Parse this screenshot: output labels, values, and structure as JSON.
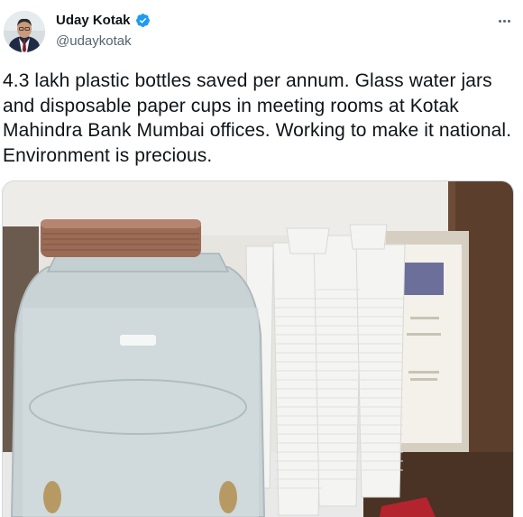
{
  "author": {
    "name": "Uday Kotak",
    "handle": "@udaykotak",
    "verified": true,
    "avatar_icon": "profile-photo"
  },
  "menu": {
    "icon": "more-horizontal-icon"
  },
  "tweet": {
    "text": "4.3 lakh plastic bottles saved per annum. Glass water jars and disposable paper cups in meeting rooms at Kotak Mahindra Bank Mumbai offices. Working to make it national. Environment is precious."
  },
  "media": {
    "description_icon": "photo-glass-jar-and-paper-cups",
    "colors": {
      "wall": "#e9e7e2",
      "wood": "#5a3d2b",
      "lid": "#9a6a55",
      "glass": "#cdd6d8",
      "cup": "#f4f4f2",
      "tray": "#efefef",
      "frame": "#d9d2c4"
    }
  },
  "colors": {
    "verified_blue": "#1d9bf0",
    "secondary_text": "#536471",
    "primary_text": "#0f1419"
  }
}
